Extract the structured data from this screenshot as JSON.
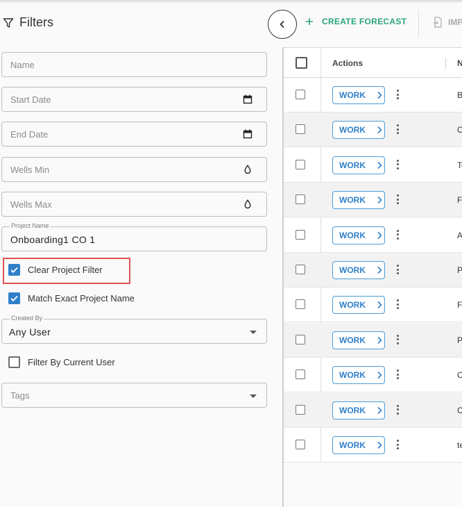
{
  "filters": {
    "title": "Filters",
    "name": {
      "placeholder": "Name"
    },
    "start_date": {
      "placeholder": "Start Date"
    },
    "end_date": {
      "placeholder": "End Date"
    },
    "wells_min": {
      "placeholder": "Wells Min"
    },
    "wells_max": {
      "placeholder": "Wells Max"
    },
    "project_name": {
      "label": "Project Name",
      "value": "Onboarding1 CO 1"
    },
    "clear_project_filter": {
      "label": "Clear Project Filter",
      "checked": true
    },
    "match_exact": {
      "label": "Match Exact Project Name",
      "checked": true
    },
    "created_by": {
      "label": "Created By",
      "value": "Any User"
    },
    "filter_current_user": {
      "label": "Filter By Current User",
      "checked": false
    },
    "tags": {
      "placeholder": "Tags"
    }
  },
  "toolbar": {
    "create_label": "CREATE FORECAST",
    "import_label": "IMP"
  },
  "table": {
    "headers": {
      "actions": "Actions",
      "name": "N"
    },
    "work_label": "WORK",
    "rows": [
      {
        "name": "B"
      },
      {
        "name": "C"
      },
      {
        "name": "Te"
      },
      {
        "name": "F"
      },
      {
        "name": "A"
      },
      {
        "name": "P"
      },
      {
        "name": "F"
      },
      {
        "name": "P"
      },
      {
        "name": "C"
      },
      {
        "name": "C"
      },
      {
        "name": "te"
      }
    ]
  },
  "colors": {
    "accent_blue": "#2f80c9",
    "create_green": "#2ba57a",
    "highlight_red": "#e15353"
  }
}
